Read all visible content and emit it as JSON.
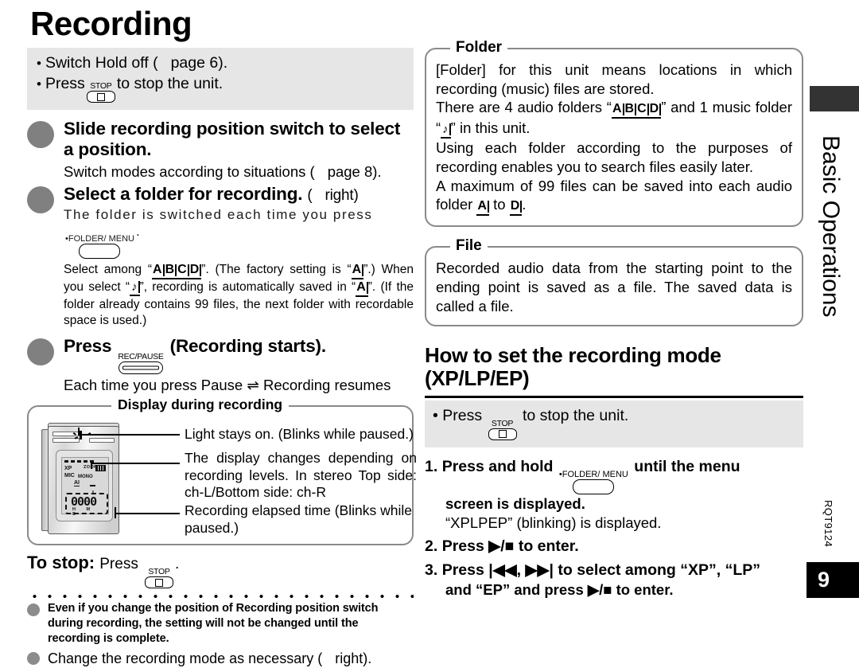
{
  "page_title": "Recording",
  "top_note": {
    "items": [
      {
        "before": "Switch Hold off (",
        "icon": "",
        "after": "page 6)."
      },
      {
        "before": "Press",
        "icon": "stop-button",
        "after": "to stop the unit."
      }
    ],
    "line1": "Switch Hold off (",
    "line1_end": "page 6).",
    "line2_start": "Press",
    "line2_end": "to stop the unit.",
    "bullet": "•"
  },
  "steps": [
    {
      "heading": "Slide recording position switch to select a position.",
      "sub_before": "Switch modes according to situations (",
      "sub_after": "page 8)."
    },
    {
      "heading": "Select a folder for recording.",
      "head_ref_before": "(",
      "head_ref_after": "right)",
      "sub_before": "The folder is switched each time you press",
      "sub_after": ".",
      "fine_1": "Select among “",
      "fine_2": "”. (The factory setting is “",
      "fine_3": "”.) When you select “",
      "fine_4": "”, recording is automatically saved in “",
      "fine_5": "”. (If the folder already contains 99 files, the next folder with recordable space is used.)"
    },
    {
      "heading_before": "Press",
      "heading_after": "(Recording starts).",
      "sub": "Each time you press   Pause ⇌ Recording resumes"
    }
  ],
  "figure": {
    "title": "Display during recording",
    "notes": [
      "Light stays on. (Blinks while paused.)",
      "The display changes depending on recording levels. In stereo Top side: ch-L/Bottom side: ch-R",
      "Recording elapsed time (Blinks while paused.)"
    ],
    "lcd": {
      "mode": "XP",
      "mic": "MIC",
      "mono": "MONO",
      "ai": "AI",
      "zoom": "ZOOM",
      "channel": "L",
      "digits": "0000",
      "units": "H M S"
    }
  },
  "to_stop": {
    "label": "To stop:",
    "press": "Press",
    "period": "."
  },
  "bottom_notes": [
    "Even if you change the position of Recording position switch during recording, the setting will not be changed until the recording is complete.",
    "Change the recording mode as necessary ("
  ],
  "bottom_note2_end": "right).",
  "folder_box": {
    "title": "Folder",
    "p1": "[Folder] for this unit means locations in which recording (music) files are stored.",
    "p2_a": "There are 4 audio folders “",
    "p2_b": "” and 1 music folder “",
    "p2_c": "” in this unit.",
    "p3": "Using each folder according to the purposes of recording enables you to search files easily later.",
    "p4_a": "A maximum of 99 files can be saved into each audio folder ",
    "p4_b": " to ",
    "p4_c": "."
  },
  "file_box": {
    "title": "File",
    "body": "Recorded audio data from the starting point to the ending point is saved as a file. The saved data is called a file."
  },
  "mode_section": {
    "heading_line1": "How to set the recording mode",
    "heading_line2": "(XP/LP/EP)",
    "band_before": "Press",
    "band_after": "to stop the unit.",
    "steps": [
      {
        "num": "1.",
        "a": "Press and hold",
        "b": "until the menu",
        "c": "screen is displayed.",
        "d": "“XPLPEP” (blinking) is displayed."
      },
      {
        "num": "2.",
        "a": "Press ▶/■ to enter."
      },
      {
        "num": "3.",
        "a": "Press |◀◀, ▶▶| to select among “XP”, “LP”",
        "b": "and “EP” and press ▶/■ to enter."
      }
    ]
  },
  "sidebar": {
    "section_title": "Basic Operations",
    "doc_code": "RQT9124",
    "page_number": "9"
  },
  "key_labels": {
    "stop": "STOP",
    "rec_pause": "REC/PAUSE",
    "folder_menu": "•FOLDER/ MENU"
  },
  "folder_letters": [
    "A",
    "B",
    "C",
    "D"
  ],
  "colors": {
    "band": "#e6e6e6",
    "bullet_gray": "#808080",
    "box_border": "#8a8a8a",
    "tab_dark": "#333333"
  }
}
